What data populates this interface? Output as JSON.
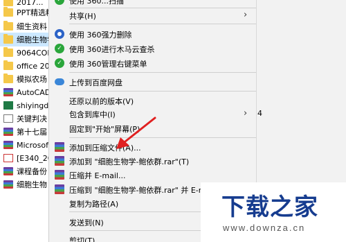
{
  "file_list": [
    {
      "label": "2017...",
      "icon": "folder-icon"
    },
    {
      "label": "PPT精选精",
      "icon": "folder-icon"
    },
    {
      "label": "细生资料",
      "icon": "folder-icon"
    },
    {
      "label": "细胞生物学",
      "icon": "folder-icon"
    },
    {
      "label": "9064CON",
      "icon": "folder-icon"
    },
    {
      "label": "office 20",
      "icon": "folder-icon"
    },
    {
      "label": "模拟农场",
      "icon": "folder-icon"
    },
    {
      "label": "AutoCAD",
      "icon": "rar-icon"
    },
    {
      "label": "shiyingde",
      "icon": "excel-icon"
    },
    {
      "label": "关键判决",
      "icon": "doc-icon"
    },
    {
      "label": "第十七届",
      "icon": "rar-icon"
    },
    {
      "label": "Microsof",
      "icon": "rar-icon"
    },
    {
      "label": "[E340_20",
      "icon": "pdf-icon"
    },
    {
      "label": "课程备份",
      "icon": "rar-icon"
    },
    {
      "label": "细胞生物",
      "icon": "rar-icon"
    }
  ],
  "menu": {
    "top_fragment": "使用 360...扫描",
    "share": "共享(H)",
    "del360": "使用 360强力删除",
    "trojan360": "使用 360进行木马云查杀",
    "manage360": "使用 360管理右键菜单",
    "baidu": "上传到百度网盘",
    "restore": "还原以前的版本(V)",
    "library": "包含到库中(I)",
    "pin_start": "固定到\"开始\"屏幕(P)",
    "add_archive": "添加到压缩文件(A)...",
    "add_rar": "添加到 \"细胞生物学-鲍依群.rar\"(T)",
    "compress_email": "压缩并 E-mail...",
    "compress_rar_email": "压缩到 \"细胞生物学-鲍依群.rar\" 并 E-ma",
    "copy_path": "复制为路径(A)",
    "send_to": "发送到(N)",
    "cut": "剪切(T)",
    "submenu_arrow": "›",
    "number_fragment": "4"
  },
  "watermark": {
    "title": "下载之家",
    "subtitle": "www.downza.cn"
  },
  "colors": {
    "selection": "#cce8ff",
    "menu_bg": "#f2f2f2",
    "watermark_blue": "#163c8f",
    "arrow_red": "#e02020"
  }
}
